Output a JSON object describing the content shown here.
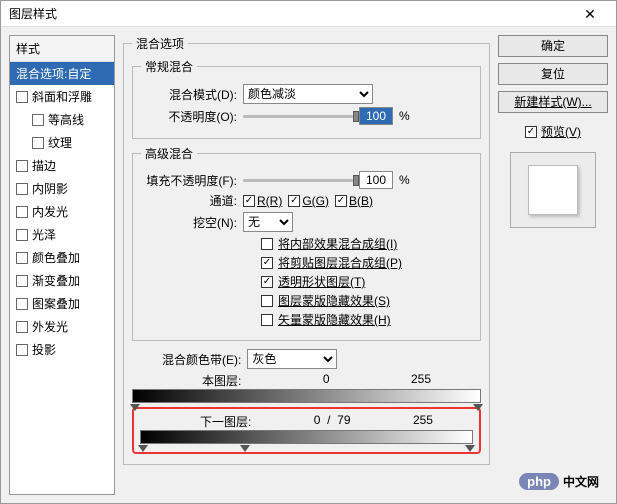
{
  "title": "图层样式",
  "sidebar": {
    "header": "样式",
    "items": [
      {
        "label": "混合选项:自定",
        "checkbox": false,
        "selected": true
      },
      {
        "label": "斜面和浮雕",
        "checkbox": true
      },
      {
        "label": "等高线",
        "checkbox": true,
        "indent": true
      },
      {
        "label": "纹理",
        "checkbox": true,
        "indent": true
      },
      {
        "label": "描边",
        "checkbox": true
      },
      {
        "label": "内阴影",
        "checkbox": true
      },
      {
        "label": "内发光",
        "checkbox": true
      },
      {
        "label": "光泽",
        "checkbox": true
      },
      {
        "label": "颜色叠加",
        "checkbox": true
      },
      {
        "label": "渐变叠加",
        "checkbox": true
      },
      {
        "label": "图案叠加",
        "checkbox": true
      },
      {
        "label": "外发光",
        "checkbox": true
      },
      {
        "label": "投影",
        "checkbox": true
      }
    ]
  },
  "blending_options": {
    "group_label": "混合选项",
    "general": {
      "group_label": "常规混合",
      "blend_mode_label": "混合模式(D):",
      "blend_mode_value": "颜色减淡",
      "opacity_label": "不透明度(O):",
      "opacity_value": "100",
      "percent": "%"
    },
    "advanced": {
      "group_label": "高级混合",
      "fill_label": "填充不透明度(F):",
      "fill_value": "100",
      "percent": "%",
      "channels_label": "通道:",
      "channel_r": "R(R)",
      "channel_g": "G(G)",
      "channel_b": "B(B)",
      "knockout_label": "挖空(N):",
      "knockout_value": "无",
      "opts": [
        {
          "label": "将内部效果混合成组(I)",
          "checked": false
        },
        {
          "label": "将剪贴图层混合成组(P)",
          "checked": true
        },
        {
          "label": "透明形状图层(T)",
          "checked": true
        },
        {
          "label": "图层蒙版隐藏效果(S)",
          "checked": false
        },
        {
          "label": "矢量蒙版隐藏效果(H)",
          "checked": false
        }
      ]
    },
    "blendif": {
      "label": "混合颜色带(E):",
      "value": "灰色",
      "this_layer": {
        "label": "本图层:",
        "lo": "0",
        "hi": "255"
      },
      "under_layer": {
        "label": "下一图层:",
        "lo": "0",
        "mid": "79",
        "hi": "255",
        "sep": "/"
      }
    }
  },
  "buttons": {
    "ok": "确定",
    "cancel": "复位",
    "new_style": "新建样式(W)...",
    "preview": "预览(V)"
  },
  "watermark": {
    "php": "php",
    "cn": "中文网"
  }
}
